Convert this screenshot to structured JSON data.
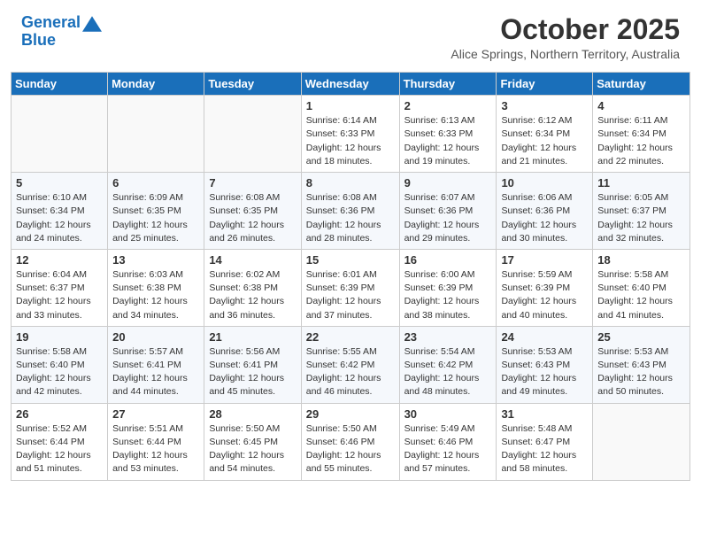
{
  "header": {
    "logo_general": "General",
    "logo_blue": "Blue",
    "month_title": "October 2025",
    "subtitle": "Alice Springs, Northern Territory, Australia"
  },
  "days_of_week": [
    "Sunday",
    "Monday",
    "Tuesday",
    "Wednesday",
    "Thursday",
    "Friday",
    "Saturday"
  ],
  "weeks": [
    [
      {
        "day": "",
        "info": ""
      },
      {
        "day": "",
        "info": ""
      },
      {
        "day": "",
        "info": ""
      },
      {
        "day": "1",
        "info": "Sunrise: 6:14 AM\nSunset: 6:33 PM\nDaylight: 12 hours\nand 18 minutes."
      },
      {
        "day": "2",
        "info": "Sunrise: 6:13 AM\nSunset: 6:33 PM\nDaylight: 12 hours\nand 19 minutes."
      },
      {
        "day": "3",
        "info": "Sunrise: 6:12 AM\nSunset: 6:34 PM\nDaylight: 12 hours\nand 21 minutes."
      },
      {
        "day": "4",
        "info": "Sunrise: 6:11 AM\nSunset: 6:34 PM\nDaylight: 12 hours\nand 22 minutes."
      }
    ],
    [
      {
        "day": "5",
        "info": "Sunrise: 6:10 AM\nSunset: 6:34 PM\nDaylight: 12 hours\nand 24 minutes."
      },
      {
        "day": "6",
        "info": "Sunrise: 6:09 AM\nSunset: 6:35 PM\nDaylight: 12 hours\nand 25 minutes."
      },
      {
        "day": "7",
        "info": "Sunrise: 6:08 AM\nSunset: 6:35 PM\nDaylight: 12 hours\nand 26 minutes."
      },
      {
        "day": "8",
        "info": "Sunrise: 6:08 AM\nSunset: 6:36 PM\nDaylight: 12 hours\nand 28 minutes."
      },
      {
        "day": "9",
        "info": "Sunrise: 6:07 AM\nSunset: 6:36 PM\nDaylight: 12 hours\nand 29 minutes."
      },
      {
        "day": "10",
        "info": "Sunrise: 6:06 AM\nSunset: 6:36 PM\nDaylight: 12 hours\nand 30 minutes."
      },
      {
        "day": "11",
        "info": "Sunrise: 6:05 AM\nSunset: 6:37 PM\nDaylight: 12 hours\nand 32 minutes."
      }
    ],
    [
      {
        "day": "12",
        "info": "Sunrise: 6:04 AM\nSunset: 6:37 PM\nDaylight: 12 hours\nand 33 minutes."
      },
      {
        "day": "13",
        "info": "Sunrise: 6:03 AM\nSunset: 6:38 PM\nDaylight: 12 hours\nand 34 minutes."
      },
      {
        "day": "14",
        "info": "Sunrise: 6:02 AM\nSunset: 6:38 PM\nDaylight: 12 hours\nand 36 minutes."
      },
      {
        "day": "15",
        "info": "Sunrise: 6:01 AM\nSunset: 6:39 PM\nDaylight: 12 hours\nand 37 minutes."
      },
      {
        "day": "16",
        "info": "Sunrise: 6:00 AM\nSunset: 6:39 PM\nDaylight: 12 hours\nand 38 minutes."
      },
      {
        "day": "17",
        "info": "Sunrise: 5:59 AM\nSunset: 6:39 PM\nDaylight: 12 hours\nand 40 minutes."
      },
      {
        "day": "18",
        "info": "Sunrise: 5:58 AM\nSunset: 6:40 PM\nDaylight: 12 hours\nand 41 minutes."
      }
    ],
    [
      {
        "day": "19",
        "info": "Sunrise: 5:58 AM\nSunset: 6:40 PM\nDaylight: 12 hours\nand 42 minutes."
      },
      {
        "day": "20",
        "info": "Sunrise: 5:57 AM\nSunset: 6:41 PM\nDaylight: 12 hours\nand 44 minutes."
      },
      {
        "day": "21",
        "info": "Sunrise: 5:56 AM\nSunset: 6:41 PM\nDaylight: 12 hours\nand 45 minutes."
      },
      {
        "day": "22",
        "info": "Sunrise: 5:55 AM\nSunset: 6:42 PM\nDaylight: 12 hours\nand 46 minutes."
      },
      {
        "day": "23",
        "info": "Sunrise: 5:54 AM\nSunset: 6:42 PM\nDaylight: 12 hours\nand 48 minutes."
      },
      {
        "day": "24",
        "info": "Sunrise: 5:53 AM\nSunset: 6:43 PM\nDaylight: 12 hours\nand 49 minutes."
      },
      {
        "day": "25",
        "info": "Sunrise: 5:53 AM\nSunset: 6:43 PM\nDaylight: 12 hours\nand 50 minutes."
      }
    ],
    [
      {
        "day": "26",
        "info": "Sunrise: 5:52 AM\nSunset: 6:44 PM\nDaylight: 12 hours\nand 51 minutes."
      },
      {
        "day": "27",
        "info": "Sunrise: 5:51 AM\nSunset: 6:44 PM\nDaylight: 12 hours\nand 53 minutes."
      },
      {
        "day": "28",
        "info": "Sunrise: 5:50 AM\nSunset: 6:45 PM\nDaylight: 12 hours\nand 54 minutes."
      },
      {
        "day": "29",
        "info": "Sunrise: 5:50 AM\nSunset: 6:46 PM\nDaylight: 12 hours\nand 55 minutes."
      },
      {
        "day": "30",
        "info": "Sunrise: 5:49 AM\nSunset: 6:46 PM\nDaylight: 12 hours\nand 57 minutes."
      },
      {
        "day": "31",
        "info": "Sunrise: 5:48 AM\nSunset: 6:47 PM\nDaylight: 12 hours\nand 58 minutes."
      },
      {
        "day": "",
        "info": ""
      }
    ]
  ]
}
